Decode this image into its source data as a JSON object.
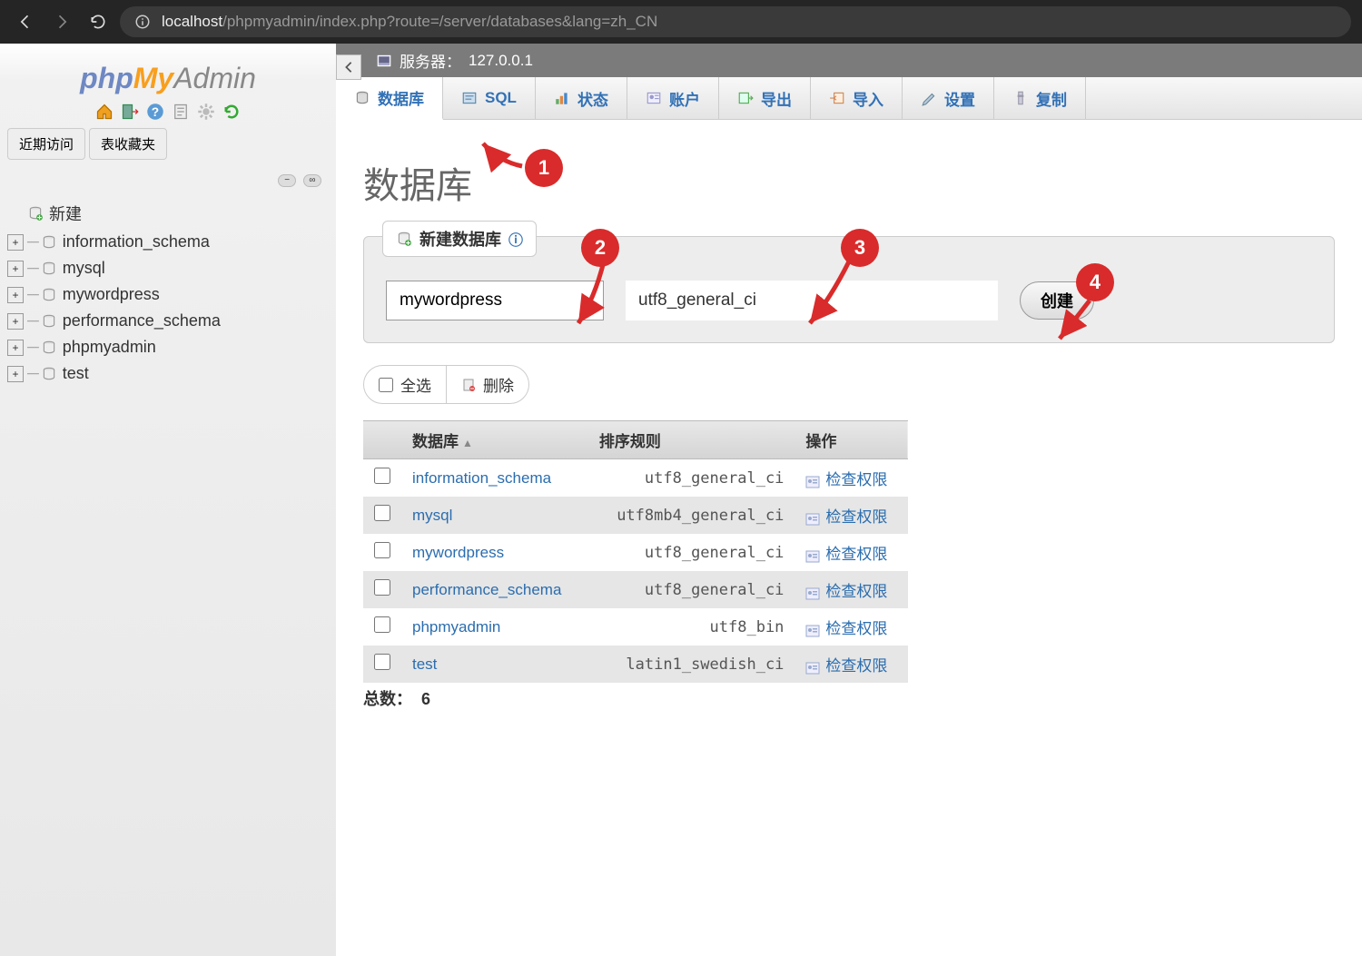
{
  "browser": {
    "url_host": "localhost",
    "url_path": "/phpmyadmin/index.php?route=/server/databases&lang=zh_CN"
  },
  "logo": {
    "p1": "php",
    "p2": "My",
    "p3": "Admin"
  },
  "sidebar": {
    "recent_tab": "近期访问",
    "favorites_tab": "表收藏夹",
    "new_label": "新建",
    "databases": [
      "information_schema",
      "mysql",
      "mywordpress",
      "performance_schema",
      "phpmyadmin",
      "test"
    ]
  },
  "server_bar": {
    "label": "服务器：",
    "host": "127.0.0.1"
  },
  "tabs": [
    {
      "label": "数据库",
      "icon": "database-icon",
      "active": true
    },
    {
      "label": "SQL",
      "icon": "sql-icon",
      "active": false
    },
    {
      "label": "状态",
      "icon": "status-icon",
      "active": false
    },
    {
      "label": "账户",
      "icon": "users-icon",
      "active": false
    },
    {
      "label": "导出",
      "icon": "export-icon",
      "active": false
    },
    {
      "label": "导入",
      "icon": "import-icon",
      "active": false
    },
    {
      "label": "设置",
      "icon": "settings-icon",
      "active": false
    },
    {
      "label": "复制",
      "icon": "replication-icon",
      "active": false
    }
  ],
  "page": {
    "title": "数据库",
    "create_legend": "新建数据库",
    "db_name_value": "mywordpress",
    "collation_value": "utf8_general_ci",
    "create_button": "创建",
    "select_all": "全选",
    "delete_label": "删除",
    "headers": {
      "db": "数据库",
      "collation": "排序规则",
      "action": "操作"
    },
    "rows": [
      {
        "name": "information_schema",
        "collation": "utf8_general_ci",
        "action": "检查权限"
      },
      {
        "name": "mysql",
        "collation": "utf8mb4_general_ci",
        "action": "检查权限"
      },
      {
        "name": "mywordpress",
        "collation": "utf8_general_ci",
        "action": "检查权限"
      },
      {
        "name": "performance_schema",
        "collation": "utf8_general_ci",
        "action": "检查权限"
      },
      {
        "name": "phpmyadmin",
        "collation": "utf8_bin",
        "action": "检查权限"
      },
      {
        "name": "test",
        "collation": "latin1_swedish_ci",
        "action": "检查权限"
      }
    ],
    "total_label": "总数：",
    "total_value": "6"
  },
  "annotations": [
    {
      "n": "1"
    },
    {
      "n": "2"
    },
    {
      "n": "3"
    },
    {
      "n": "4"
    }
  ]
}
